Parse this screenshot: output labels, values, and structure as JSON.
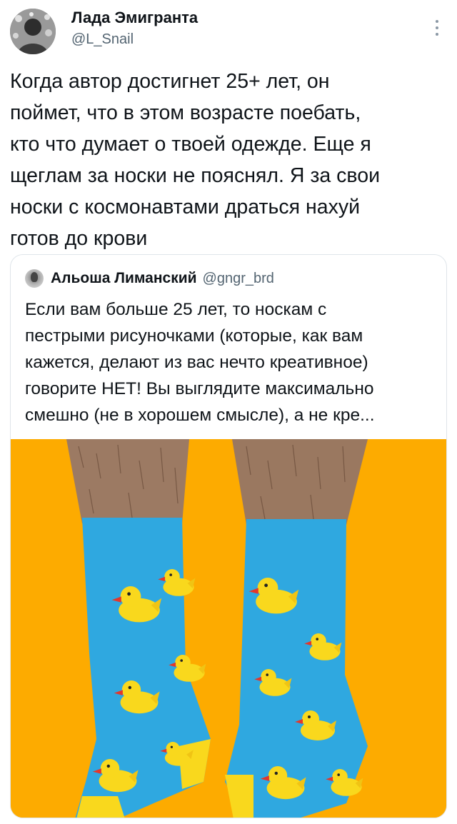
{
  "tweet": {
    "author": {
      "name": "Лада Эмигранта",
      "handle": "@L_Snail",
      "avatar_icon": "profile-avatar"
    },
    "more_icon": "more-vertical-icon",
    "text": "Когда автор достигнет 25+ лет, он\nпоймет, что в этом возрасте поебать,\nкто что думает о твоей одежде. Еще я\nщеглам за носки не пояснял. Я за свои\nноски с космонавтами драться нахуй\nготов до крови"
  },
  "quote": {
    "author": {
      "name": "Альоша Лиманский",
      "handle": "@gngr_brd",
      "avatar_icon": "profile-avatar"
    },
    "text": "Если вам больше 25 лет, то носкам с\nпестрыми рисуночками (которые, как вам\nкажется, делают из вас нечто креативное)\nговорите НЕТ! Вы выглядите максимально\nсмешно (не в хорошем смысле), а не кре...",
    "media": {
      "icon": "rubber-duck-socks-photo",
      "background_color": "#fdab00",
      "sock_color": "#2fa8e0",
      "duck_color": "#f9d81d",
      "beak_color": "#e3372b"
    }
  }
}
